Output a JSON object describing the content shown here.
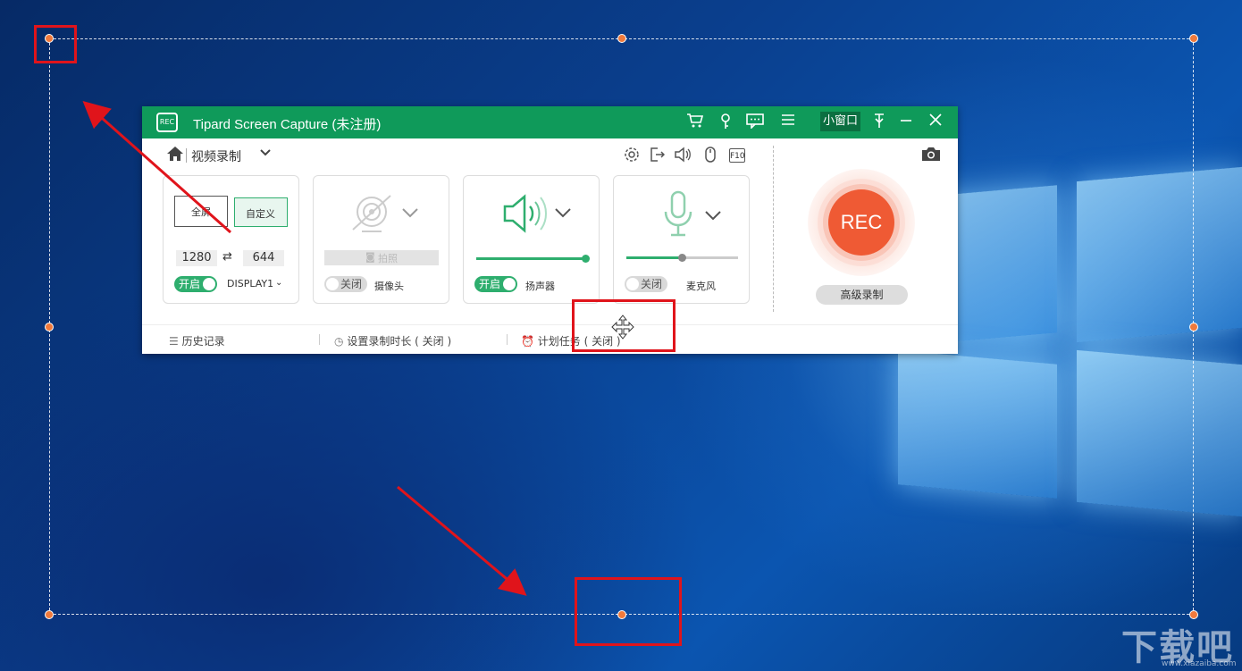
{
  "app": {
    "title": "Tipard Screen Capture (未注册)",
    "logo_text": "REC",
    "mini_window_label": "小窗口"
  },
  "titlebar_icons": [
    "cart-icon",
    "key-icon",
    "feedback-icon",
    "menu-icon",
    "pin-icon",
    "minimize-icon",
    "close-icon"
  ],
  "toolbar": {
    "mode_label": "视频录制",
    "icons": [
      "gear-icon",
      "export-icon",
      "speaker-icon",
      "mouse-icon",
      "f10-icon"
    ],
    "f10_label": "F10"
  },
  "display_card": {
    "full_screen_label": "全屏",
    "custom_label": "自定义",
    "width": "1280",
    "height": "644",
    "toggle_label": "开启",
    "display_select": "DISPLAY1"
  },
  "camera_card": {
    "snapshot_label": "拍照",
    "toggle_label": "关闭",
    "label": "摄像头"
  },
  "speaker_card": {
    "toggle_label": "开启",
    "label": "扬声器",
    "volume": 1.0
  },
  "mic_card": {
    "toggle_label": "关闭",
    "label": "麦克风",
    "volume": 0.5
  },
  "rec": {
    "rec_label": "REC",
    "advanced_label": "高级录制"
  },
  "footer": {
    "history": "历史记录",
    "duration": "设置录制时长 ( 关闭 )",
    "schedule": "计划任务 ( 关闭 )"
  },
  "watermark": {
    "text": "下载吧",
    "url": "www.xiazaiba.com"
  },
  "colors": {
    "titlebar": "#0f9a5a",
    "rec": "#ef5a34",
    "handle": "#f07a3c",
    "highlight": "#e0141b"
  }
}
